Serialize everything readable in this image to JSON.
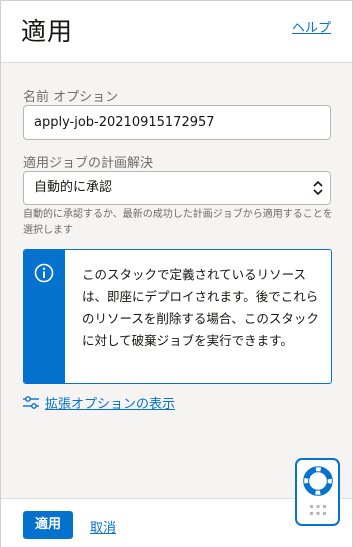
{
  "header": {
    "title": "適用",
    "help_link": "ヘルプ"
  },
  "name_field": {
    "label": "名前 オプション",
    "value": "apply-job-20210915172957"
  },
  "plan_field": {
    "label": "適用ジョブの計画解決",
    "selected": "自動的に承認",
    "help_text": "自動的に承認するか、最新の成功した計画ジョブから適用することを選択します"
  },
  "info": {
    "message": "このスタックで定義されているリソースは、即座にデプロイされます。後でこれらのリソースを削除する場合、このスタックに対して破棄ジョブを実行できます。",
    "icon": "info-icon",
    "accent": "#0572ce"
  },
  "advanced_link": "拡張オプションの表示",
  "footer": {
    "apply_label": "適用",
    "cancel_label": "取消"
  }
}
